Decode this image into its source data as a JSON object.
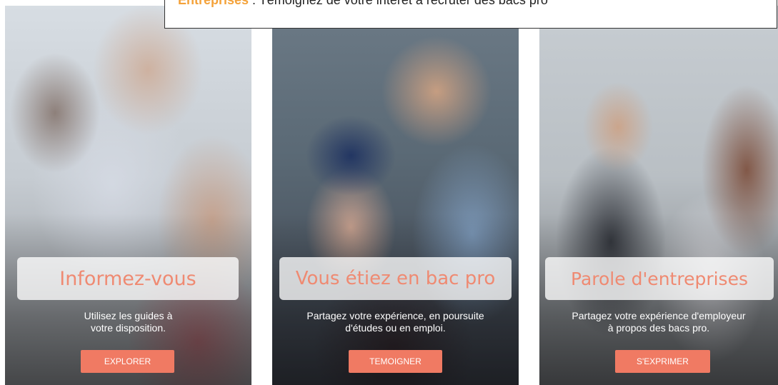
{
  "banner": {
    "highlight": "Entreprises",
    "text": " : Témoignez de votre intérêt à recruter des bacs pro"
  },
  "cards": [
    {
      "title": "Informez-vous",
      "description": [
        "Utilisez les guides à",
        "votre disposition."
      ],
      "button_label": "EXPLORER"
    },
    {
      "title": "Vous étiez en bac pro",
      "description": [
        "Partagez votre expérience, en poursuite",
        "d'études ou en emploi."
      ],
      "button_label": "TEMOIGNER"
    },
    {
      "title": "Parole d'entreprises",
      "description": [
        "Partagez votre expérience d'employeur",
        "à propos des bacs pro."
      ],
      "button_label": "S'EXPRIMER"
    }
  ],
  "colors": {
    "accent": "#f07a63",
    "title_text": "#ef8a72",
    "banner_highlight": "#f4a23a"
  }
}
